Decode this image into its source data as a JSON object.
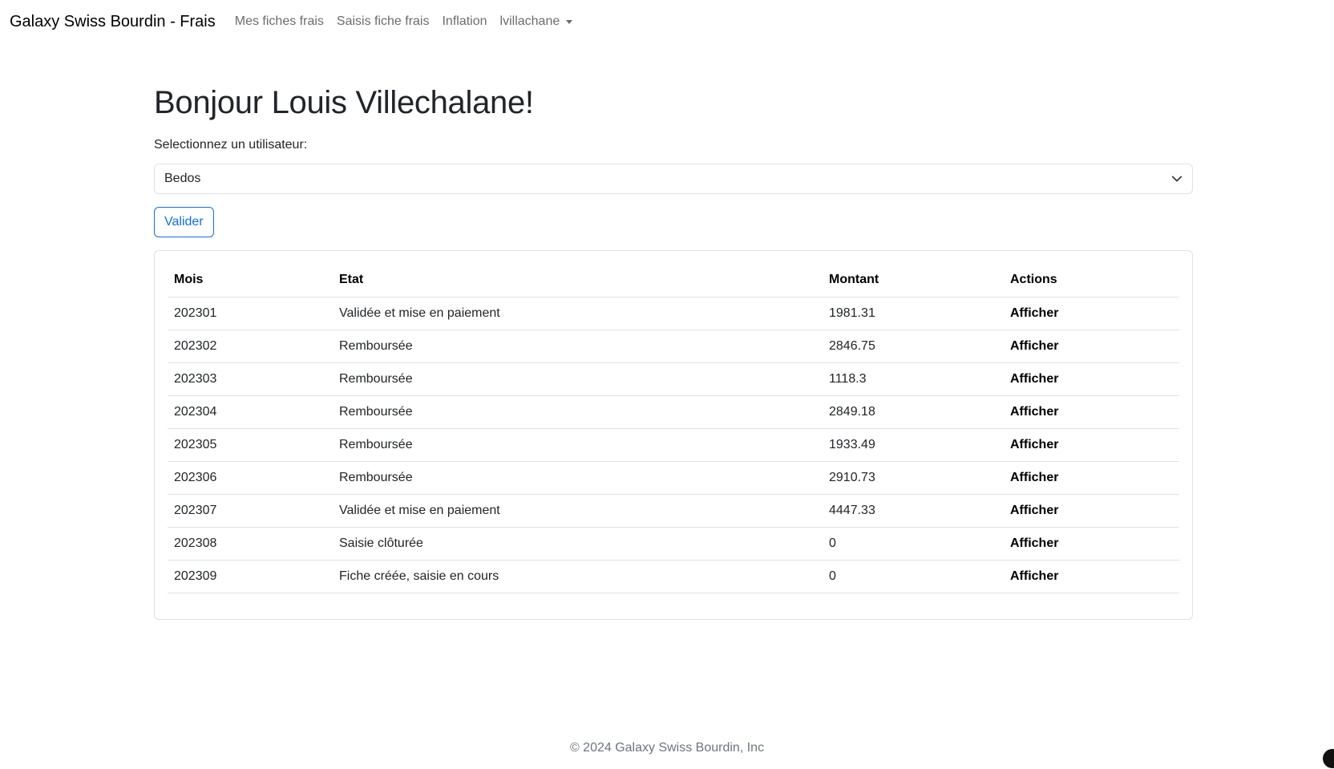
{
  "navbar": {
    "brand": "Galaxy Swiss Bourdin - Frais",
    "links": [
      {
        "label": "Mes fiches frais"
      },
      {
        "label": "Saisis fiche frais"
      },
      {
        "label": "Inflation"
      },
      {
        "label": "lvillachane"
      }
    ]
  },
  "main": {
    "greeting": "Bonjour Louis Villechalane!",
    "select_label": "Selectionnez un utilisateur:",
    "selected_user": "Bedos",
    "submit_label": "Valider"
  },
  "table": {
    "headers": [
      "Mois",
      "Etat",
      "Montant",
      "Actions"
    ],
    "rows": [
      {
        "mois": "202301",
        "etat": "Validée et mise en paiement",
        "montant": "1981.31",
        "action": "Afficher"
      },
      {
        "mois": "202302",
        "etat": "Remboursée",
        "montant": "2846.75",
        "action": "Afficher"
      },
      {
        "mois": "202303",
        "etat": "Remboursée",
        "montant": "1118.3",
        "action": "Afficher"
      },
      {
        "mois": "202304",
        "etat": "Remboursée",
        "montant": "2849.18",
        "action": "Afficher"
      },
      {
        "mois": "202305",
        "etat": "Remboursée",
        "montant": "1933.49",
        "action": "Afficher"
      },
      {
        "mois": "202306",
        "etat": "Remboursée",
        "montant": "2910.73",
        "action": "Afficher"
      },
      {
        "mois": "202307",
        "etat": "Validée et mise en paiement",
        "montant": "4447.33",
        "action": "Afficher"
      },
      {
        "mois": "202308",
        "etat": "Saisie clôturée",
        "montant": "0",
        "action": "Afficher"
      },
      {
        "mois": "202309",
        "etat": "Fiche créée, saisie en cours",
        "montant": "0",
        "action": "Afficher"
      }
    ]
  },
  "footer": {
    "copyright": "© 2024 Galaxy Swiss Bourdin, Inc"
  },
  "colors": {
    "primary": "#0d6efd",
    "border": "#dee2e6",
    "muted": "#6c757d"
  }
}
